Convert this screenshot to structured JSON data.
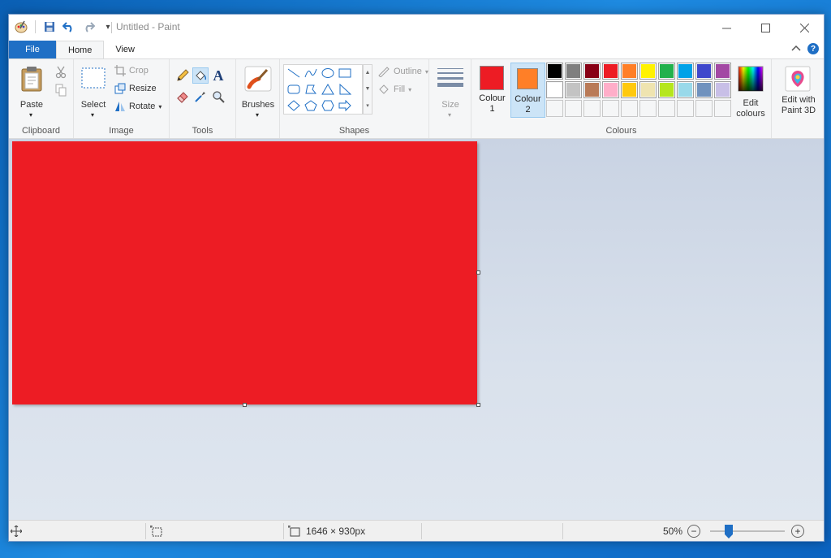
{
  "window": {
    "title": "Untitled - Paint",
    "qat_dropdown": "▾"
  },
  "tabs": {
    "file": "File",
    "home": "Home",
    "view": "View"
  },
  "ribbon": {
    "clipboard": {
      "paste": "Paste",
      "group_label": "Clipboard"
    },
    "image": {
      "select": "Select",
      "crop": "Crop",
      "resize": "Resize",
      "rotate": "Rotate",
      "group_label": "Image"
    },
    "tools": {
      "group_label": "Tools",
      "text_tool": "A"
    },
    "brushes": {
      "label": "Brushes"
    },
    "shapes": {
      "outline": "Outline",
      "fill": "Fill",
      "group_label": "Shapes"
    },
    "size": {
      "label": "Size"
    },
    "colours": {
      "colour1_line1": "Colour",
      "colour1_line2": "1",
      "colour2_line1": "Colour",
      "colour2_line2": "2",
      "colour1_value": "#ed1c24",
      "colour2_value": "#ff7f27",
      "group_label": "Colours",
      "edit_line1": "Edit",
      "edit_line2": "colours",
      "palette_row1": [
        "#000000",
        "#7f7f7f",
        "#880015",
        "#ed1c24",
        "#ff7f27",
        "#fff200",
        "#22b14c",
        "#00a2e8",
        "#3f48cc",
        "#a349a4"
      ],
      "palette_row2": [
        "#ffffff",
        "#c3c3c3",
        "#b97a57",
        "#ffaec9",
        "#ffc90e",
        "#efe4b0",
        "#b5e61d",
        "#99d9ea",
        "#7092be",
        "#c8bfe7"
      ]
    },
    "paint3d": {
      "line1": "Edit with",
      "line2": "Paint 3D"
    }
  },
  "canvas": {
    "fill_color": "#ed1c24"
  },
  "status": {
    "dimensions": "1646 × 930px",
    "zoom": "50%",
    "zoom_level": 50
  }
}
